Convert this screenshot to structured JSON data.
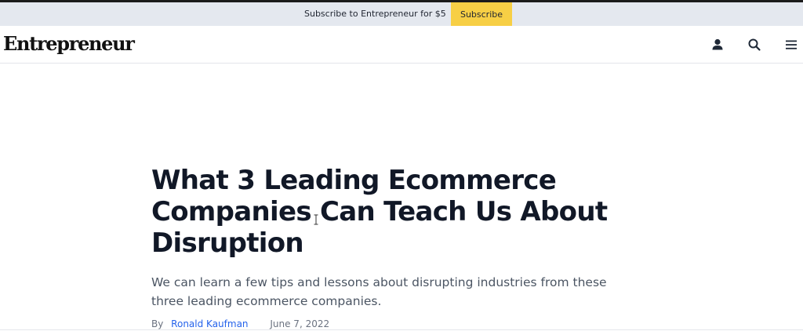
{
  "promo": {
    "text": "Subscribe to Entrepreneur for $5",
    "button_label": "Subscribe"
  },
  "header": {
    "logo": "Entrepreneur",
    "icons": [
      "user-icon",
      "search-icon",
      "menu-icon"
    ]
  },
  "article": {
    "headline": "What 3 Leading Ecommerce Companies Can Teach Us About Disruption",
    "dek": "We can learn a few tips and lessons about disrupting industries from these three leading ecommerce companies.",
    "byline_prefix": "By",
    "author": "Ronald Kaufman",
    "date": "June 7, 2022"
  },
  "colors": {
    "promo_bg": "#e4e8ef",
    "subscribe_button": "#f7cf45",
    "headline": "#111827",
    "author_link": "#2563eb"
  }
}
